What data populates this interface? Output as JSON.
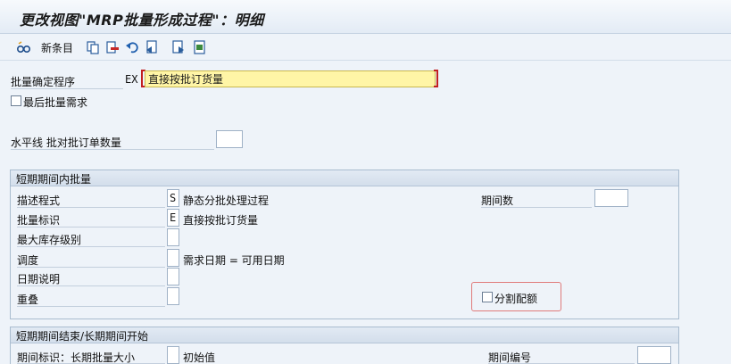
{
  "window": {
    "title": "更改视图\"MRP批量形成过程\"：明细"
  },
  "toolbar": {
    "new_entries_label": "新条目",
    "icons": [
      "glasses-icon",
      "copy-icon",
      "delete-icon",
      "undo-icon",
      "previous-entry-icon",
      "next-entry-icon",
      "export-icon"
    ]
  },
  "header": {
    "lot_sizing_proc_label": "批量确定程序",
    "lot_sizing_proc_code": "EX",
    "lot_sizing_proc_value": "直接按批订货量",
    "last_lot_req_label": "最后批量需求",
    "horizon_label": "水平线 批对批订单数量",
    "horizon_value": ""
  },
  "short_term": {
    "title": "短期期间内批量",
    "descr_label": "描述程式",
    "descr_code": "S",
    "descr_text": "静态分批处理过程",
    "lot_ind_label": "批量标识",
    "lot_ind_code": "E",
    "lot_ind_text": "直接按批订货量",
    "max_stock_label": "最大库存级别",
    "max_stock_value": "",
    "scheduling_label": "调度",
    "scheduling_value": "",
    "scheduling_text": "需求日期 = 可用日期",
    "date_spec_label": "日期说明",
    "date_spec_value": "",
    "overlap_label": "重叠",
    "overlap_value": "",
    "periods_label": "期间数",
    "periods_value": "",
    "split_quota_label": "分割配额"
  },
  "long_term": {
    "title": "短期期间结束/长期期间开始",
    "period_ind_label": "期间标识：长期批量大小",
    "period_ind_value": "",
    "period_ind_text": "初始值",
    "period_no_label": "期间编号",
    "period_no_value": ""
  }
}
